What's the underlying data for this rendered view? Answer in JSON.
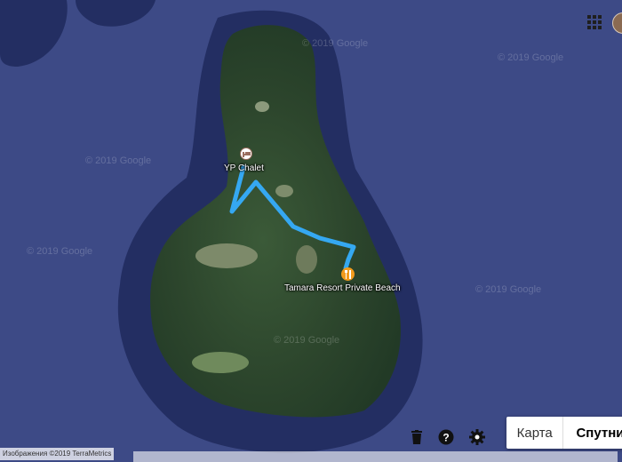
{
  "map": {
    "type": "satellite",
    "watermark_text": "© 2019 Google",
    "colors": {
      "water": "#3d4a86",
      "reef": "#232e62",
      "land": "#2f4a2e",
      "route": "#35a8f2"
    }
  },
  "places": {
    "hotel": {
      "label": "YP Chalet",
      "icon": "hotel-bed-icon"
    },
    "restaurant": {
      "label": "Tamara Resort Private Beach",
      "icon": "restaurant-fork-knife-icon"
    }
  },
  "header": {
    "apps_icon": "apps-grid-icon",
    "avatar": "account-avatar"
  },
  "controls": {
    "delete_icon": "trash-icon",
    "help_icon": "help-icon",
    "settings_icon": "gear-icon",
    "map_type": {
      "map_label": "Карта",
      "satellite_label": "Спутник",
      "selected": "satellite"
    }
  },
  "attribution": {
    "text": "Изображения ©2019 TerraMetrics"
  }
}
